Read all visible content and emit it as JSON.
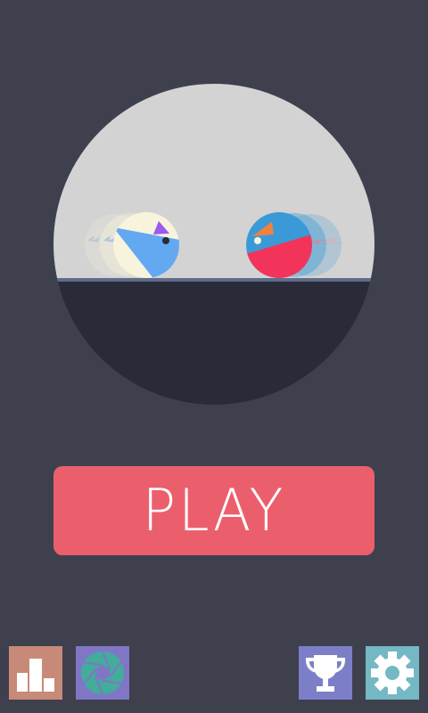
{
  "play_button": {
    "label": "PLAY"
  },
  "icons": {
    "leaderboard": "leaderboard-icon",
    "aperture": "aperture-icon",
    "trophy": "trophy-icon",
    "settings": "gear-icon"
  },
  "colors": {
    "background": "#3f404e",
    "sky": "#d3d3d3",
    "ground": "#292b38",
    "ground_edge": "#5f6d8a",
    "play_button": "#eb5f6d",
    "player_body": "#f8f3dc",
    "player_accent": "#62a9f2",
    "player_crest": "#9a59f0",
    "opponent_body": "#3a9ad8",
    "opponent_accent": "#f2345a",
    "opponent_crest": "#f2813d",
    "tile_leaderboard": "#c88a78",
    "tile_aperture": "#7f77c6",
    "aperture_lens": "#41ad9a",
    "tile_trophy": "#7c7fc8",
    "tile_settings": "#74b8c3"
  }
}
